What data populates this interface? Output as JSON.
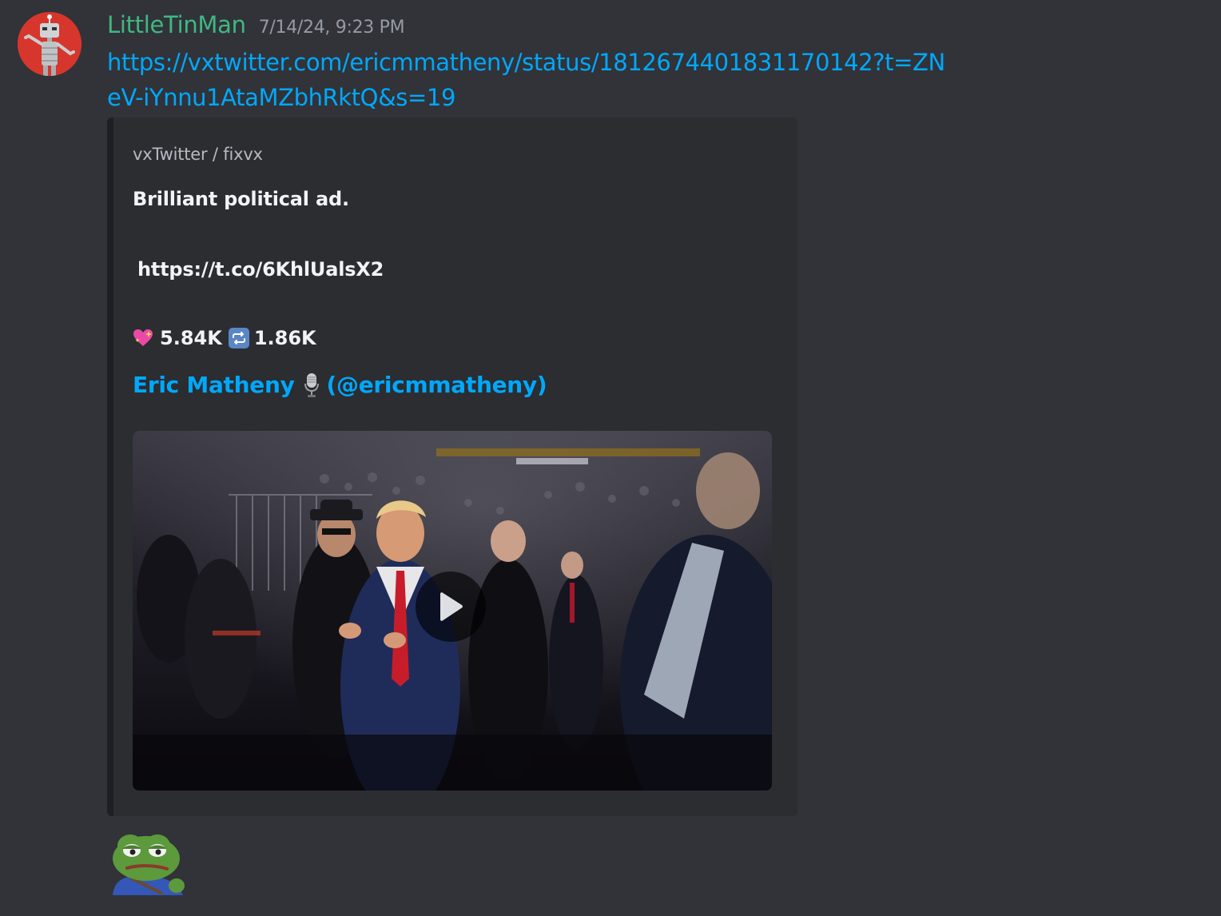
{
  "message": {
    "username": "LittleTinMan",
    "timestamp": "7/14/24, 9:23 PM",
    "link": "https://vxtwitter.com/ericmmatheny/status/1812674401831170142?t=ZNeV-iYnnu1AtaMZbhRktQ&s=19"
  },
  "embed": {
    "provider": "vxTwitter / fixvx",
    "description_line1": "Brilliant political ad.",
    "description_link": "https://t.co/6KhlUalsX2",
    "likes": "5.84K",
    "retweets": "1.86K",
    "author_name": "Eric Matheny",
    "author_handle": "(@ericmmatheny)"
  },
  "icons": {
    "heart": "sparkling-heart-icon",
    "retweet": "repeat-icon",
    "author_emoji": "microphone-icon",
    "play": "play-icon",
    "sticker": "pepe-frog-sticker"
  },
  "colors": {
    "background": "#313338",
    "embed_background": "#2b2d31",
    "username": "#3fb883",
    "link": "#00a8fc",
    "text": "#f2f3f5",
    "muted": "#949ba4"
  }
}
